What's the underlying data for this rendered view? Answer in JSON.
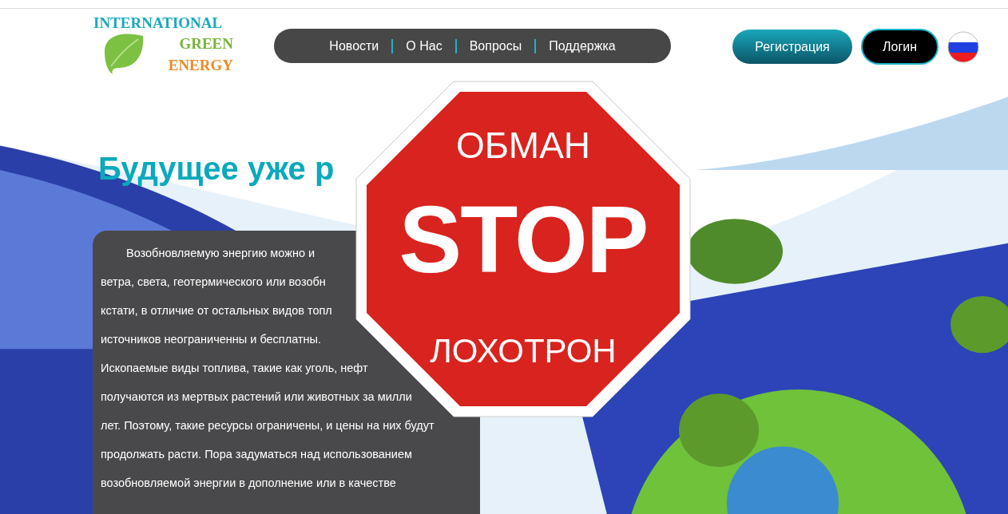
{
  "logo": {
    "lines": [
      "INTERNATIONAL",
      "GREEN",
      "ENERGY"
    ]
  },
  "nav": {
    "items": [
      "Новости",
      "О Нас",
      "Вопросы",
      "Поддержка"
    ]
  },
  "header_buttons": {
    "register": "Регистрация",
    "login": "Логин"
  },
  "hero": {
    "heading": "Будущее уже р",
    "text_lines": [
      "Возобновляемую энергию можно и",
      "ветра, света, геотермического или возобн",
      "кстати, в отличие от остальных видов топл",
      "источников неограниченны и бесплатны.",
      "Ископаемые виды топлива, такие как уголь, нефт",
      "получаются из мертвых растений или животных за милли",
      "лет. Поэтому, такие ресурсы ограничены, и цены на них будут",
      "продолжать расти. Пора задуматься над использованием",
      "возобновляемой энергии в дополнение или в качестве"
    ]
  },
  "stop_sign": {
    "top": "ОБМАН",
    "center": "STOP",
    "bottom": "ЛОХОТРОН"
  }
}
